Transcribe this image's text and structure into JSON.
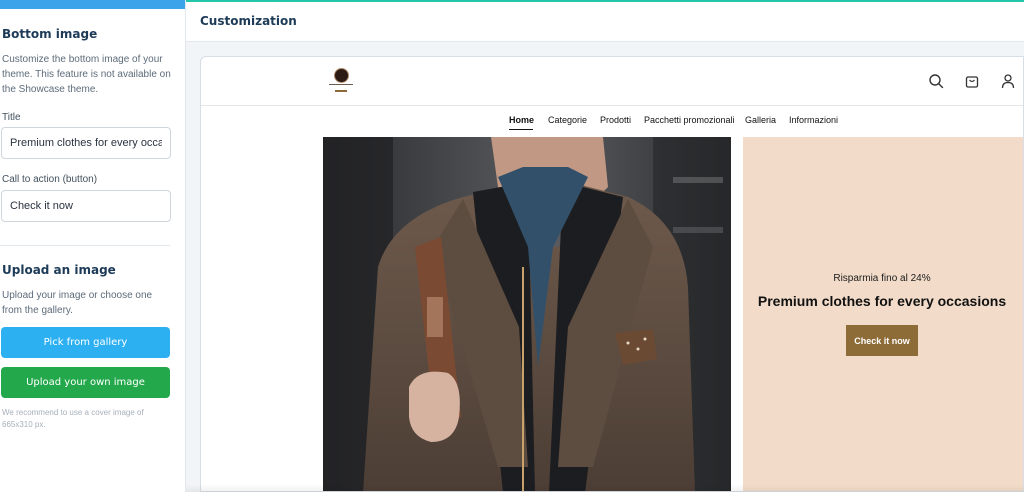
{
  "sidebar": {
    "bottom_image": {
      "heading": "Bottom image",
      "description": "Customize the bottom image of your theme. This feature is not available on the Showcase theme.",
      "title_label": "Title",
      "title_value": "Premium clothes for every occasions",
      "cta_label": "Call to action (button)",
      "cta_value": "Check it now"
    },
    "upload": {
      "heading": "Upload an image",
      "description": "Upload your image or choose one from the gallery.",
      "gallery_button": "Pick from gallery",
      "upload_button": "Upload your own image",
      "note": "We recommend to use a cover image of 665x310 px."
    }
  },
  "header": {
    "title": "Customization"
  },
  "preview": {
    "nav": [
      "Home",
      "Categorie",
      "Prodotti",
      "Pacchetti promozionali",
      "Galleria",
      "Informazioni"
    ],
    "promo": {
      "subtitle": "Risparmia fino al 24%",
      "title": "Premium clothes for every occasions",
      "button": "Check it now",
      "bg_color": "#f2dcc9",
      "button_color": "#8e6c38"
    },
    "header_icons": [
      "search-icon",
      "shopping-bag-icon",
      "user-icon"
    ]
  },
  "colors": {
    "accent_blue": "#2cb0f2",
    "accent_green": "#23a94c",
    "top_line": "#22c7a9"
  }
}
